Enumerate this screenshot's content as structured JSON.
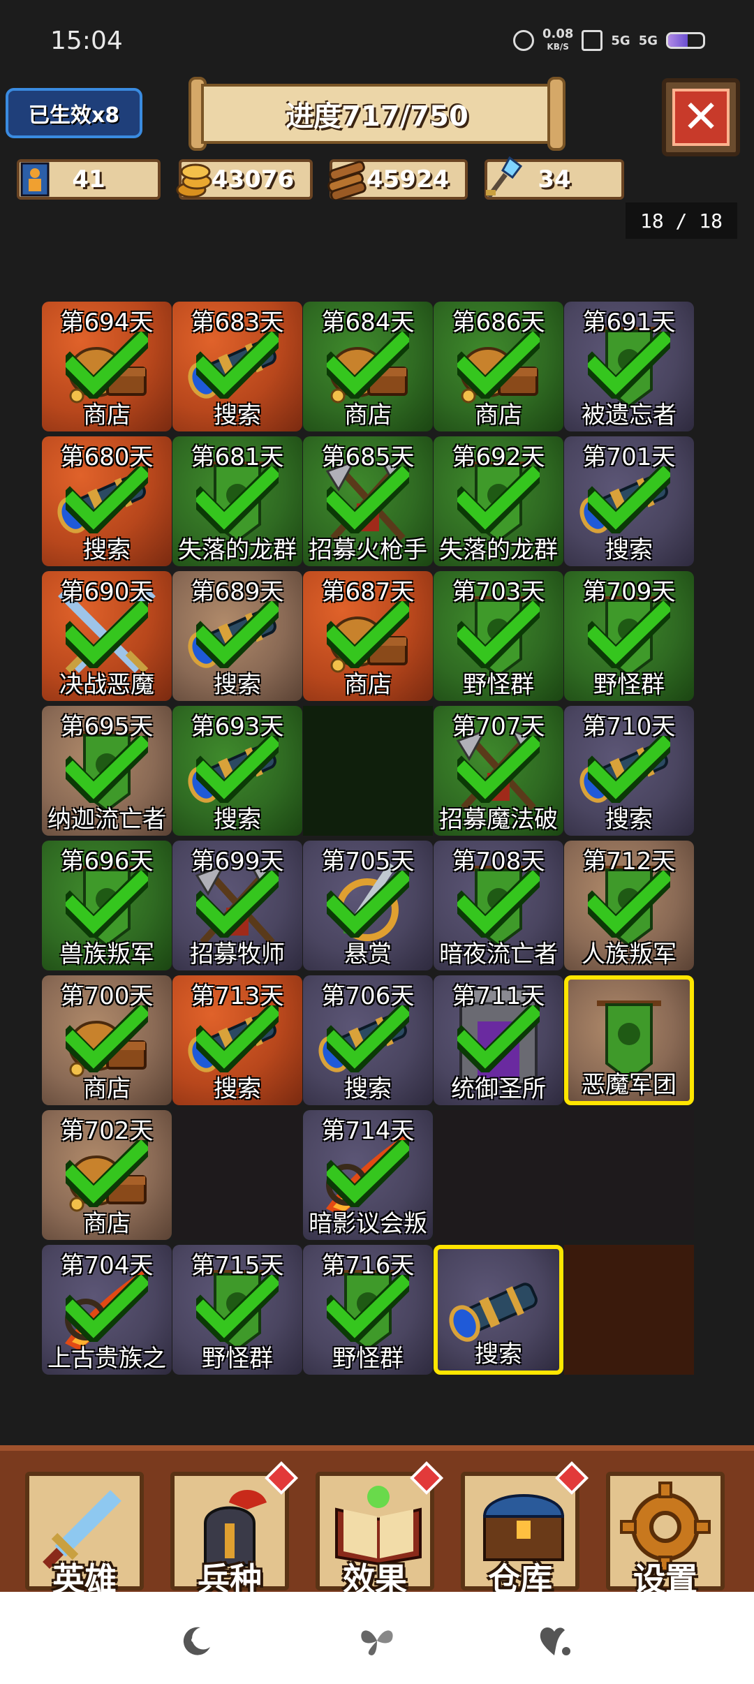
{
  "status_bar": {
    "time": "15:04",
    "net_speed_value": "0.08",
    "net_speed_unit": "KB/S",
    "sim1": "5G",
    "sim2": "5G",
    "battery_level": 0.55
  },
  "hud": {
    "effect_badge": "已生效x8",
    "progress_text": "进度717/750",
    "resources": [
      {
        "icon": "soldier-icon",
        "value": "41"
      },
      {
        "icon": "gold-coins-icon",
        "value": "43076"
      },
      {
        "icon": "wood-logs-icon",
        "value": "45924"
      },
      {
        "icon": "crystal-key-icon",
        "value": "34"
      }
    ],
    "page_indicator": "18 / 18"
  },
  "colors": {
    "fire_bg": "#b8471c",
    "forest_bg": "#2f6a22",
    "stone_bg": "#4a4560",
    "sand_bg": "#8a6a55",
    "check": "#35c61e",
    "highlight": "#ffe600"
  },
  "tiles": [
    [
      {
        "day": "第694天",
        "name": "商店",
        "bg": "fire",
        "icon": "treasure-sack-icon",
        "done": true
      },
      {
        "day": "第683天",
        "name": "搜索",
        "bg": "fire",
        "icon": "spyglass-icon",
        "done": true
      },
      {
        "day": "第684天",
        "name": "商店",
        "bg": "forest",
        "icon": "treasure-sack-icon",
        "done": true
      },
      {
        "day": "第686天",
        "name": "商店",
        "bg": "forest",
        "icon": "treasure-sack-icon",
        "done": true
      },
      {
        "day": "第691天",
        "name": "被遗忘者",
        "bg": "stone",
        "icon": "banner-icon",
        "done": true
      }
    ],
    [
      {
        "day": "第680天",
        "name": "搜索",
        "bg": "fire",
        "icon": "spyglass-icon",
        "done": true
      },
      {
        "day": "第681天",
        "name": "失落的龙群",
        "bg": "forest",
        "icon": "banner-icon",
        "done": true
      },
      {
        "day": "第685天",
        "name": "招募火枪手",
        "bg": "forest",
        "icon": "crossed-axes-icon",
        "done": true
      },
      {
        "day": "第692天",
        "name": "失落的龙群",
        "bg": "forest",
        "icon": "banner-icon",
        "done": true
      },
      {
        "day": "第701天",
        "name": "搜索",
        "bg": "stone",
        "icon": "spyglass-icon",
        "done": true
      }
    ],
    [
      {
        "day": "第690天",
        "name": "决战恶魔",
        "bg": "fire",
        "icon": "crossed-swords-icon",
        "done": true
      },
      {
        "day": "第689天",
        "name": "搜索",
        "bg": "sand",
        "icon": "spyglass-icon",
        "done": true
      },
      {
        "day": "第687天",
        "name": "商店",
        "bg": "fire",
        "icon": "treasure-sack-icon",
        "done": true
      },
      {
        "day": "第703天",
        "name": "野怪群",
        "bg": "forest",
        "icon": "banner-icon",
        "done": true
      },
      {
        "day": "第709天",
        "name": "野怪群",
        "bg": "forest",
        "icon": "banner-icon",
        "done": true
      }
    ],
    [
      {
        "day": "第695天",
        "name": "纳迦流亡者",
        "bg": "sand",
        "icon": "banner-icon",
        "done": true
      },
      {
        "day": "第693天",
        "name": "搜索",
        "bg": "forest",
        "icon": "spyglass-icon",
        "done": true
      },
      {
        "day": "",
        "name": "",
        "bg": "empty-forest",
        "icon": "",
        "done": false
      },
      {
        "day": "第707天",
        "name": "招募魔法破",
        "bg": "forest",
        "icon": "crossed-axes-icon",
        "done": true
      },
      {
        "day": "第710天",
        "name": "搜索",
        "bg": "stone",
        "icon": "spyglass-icon",
        "done": true
      }
    ],
    [
      {
        "day": "第696天",
        "name": "兽族叛军",
        "bg": "forest",
        "icon": "banner-icon",
        "done": true
      },
      {
        "day": "第699天",
        "name": "招募牧师",
        "bg": "stone",
        "icon": "crossed-axes-icon",
        "done": true
      },
      {
        "day": "第705天",
        "name": "悬赏",
        "bg": "stone",
        "icon": "dagger-icon",
        "done": true
      },
      {
        "day": "第708天",
        "name": "暗夜流亡者",
        "bg": "stone",
        "icon": "banner-icon",
        "done": true
      },
      {
        "day": "第712天",
        "name": "人族叛军",
        "bg": "sand",
        "icon": "banner-icon",
        "done": true
      }
    ],
    [
      {
        "day": "第700天",
        "name": "商店",
        "bg": "sand",
        "icon": "treasure-sack-icon",
        "done": true
      },
      {
        "day": "第713天",
        "name": "搜索",
        "bg": "fire",
        "icon": "spyglass-icon",
        "done": true
      },
      {
        "day": "第706天",
        "name": "搜索",
        "bg": "stone",
        "icon": "spyglass-icon",
        "done": true
      },
      {
        "day": "第711天",
        "name": "统御圣所",
        "bg": "stone",
        "icon": "sanctuary-icon",
        "done": true
      },
      {
        "day": "",
        "name": "恶魔军团",
        "bg": "sand",
        "icon": "banner-icon",
        "done": false,
        "current": true
      }
    ],
    [
      {
        "day": "第702天",
        "name": "商店",
        "bg": "sand",
        "icon": "treasure-sack-icon",
        "done": true
      },
      {
        "day": "",
        "name": "",
        "bg": "empty-stone",
        "icon": "",
        "done": false
      },
      {
        "day": "第714天",
        "name": "暗影议会叛",
        "bg": "stone",
        "icon": "fire-slash-icon",
        "done": true
      },
      {
        "day": "",
        "name": "",
        "bg": "empty-stone",
        "icon": "",
        "done": false
      },
      {
        "day": "",
        "name": "",
        "bg": "empty-stone",
        "icon": "",
        "done": false
      }
    ],
    [
      {
        "day": "第704天",
        "name": "上古贵族之",
        "bg": "stone",
        "icon": "fire-slash-icon",
        "done": true
      },
      {
        "day": "第715天",
        "name": "野怪群",
        "bg": "stone",
        "icon": "banner-icon",
        "done": true
      },
      {
        "day": "第716天",
        "name": "野怪群",
        "bg": "stone",
        "icon": "banner-icon",
        "done": true
      },
      {
        "day": "",
        "name": "搜索",
        "bg": "stone",
        "icon": "spyglass-icon",
        "done": false,
        "current": true
      },
      {
        "day": "",
        "name": "",
        "bg": "empty-dirt",
        "icon": "",
        "done": false
      }
    ]
  ],
  "bottom_nav": [
    {
      "label": "英雄",
      "icon": "sword-icon",
      "badge": false
    },
    {
      "label": "兵种",
      "icon": "knight-helmet-icon",
      "badge": true
    },
    {
      "label": "效果",
      "icon": "spellbook-icon",
      "badge": true
    },
    {
      "label": "仓库",
      "icon": "treasure-chest-icon",
      "badge": true
    },
    {
      "label": "设置",
      "icon": "gear-icon",
      "badge": false
    }
  ],
  "system_nav": [
    {
      "icon": "moon-icon"
    },
    {
      "icon": "butterfly-icon"
    },
    {
      "icon": "heart-icon"
    }
  ]
}
